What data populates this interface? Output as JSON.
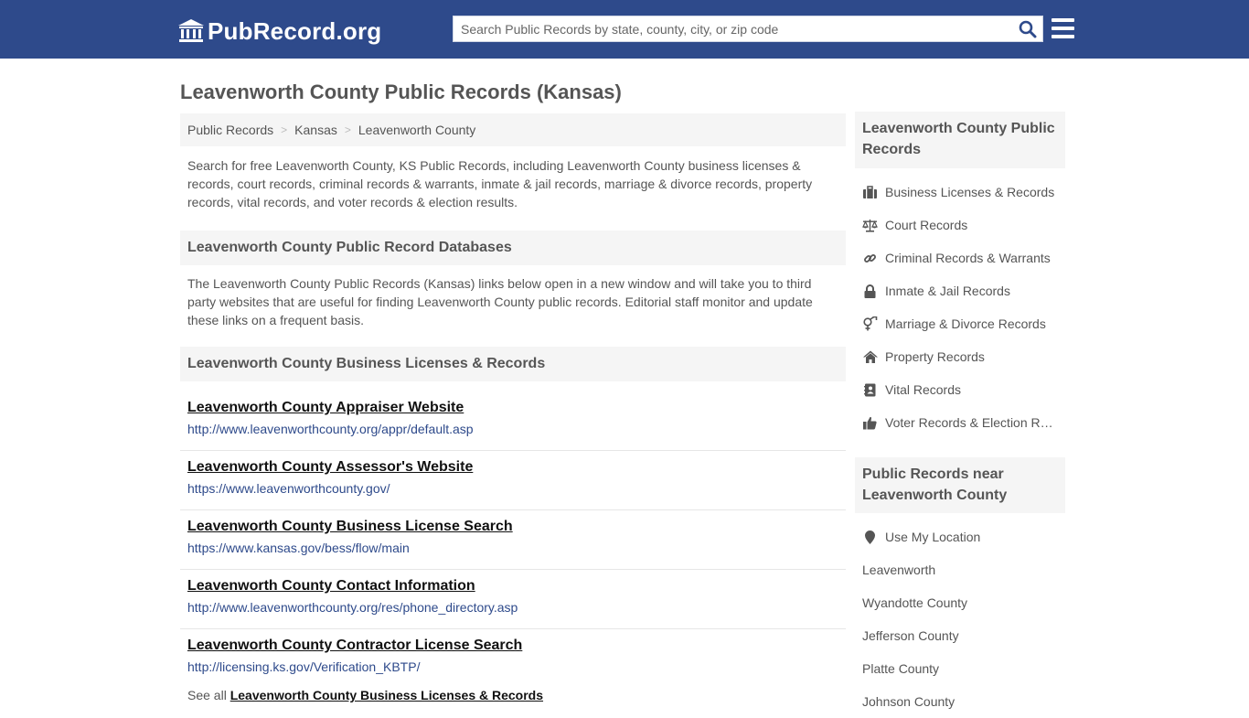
{
  "header": {
    "logo_text": "PubRecord.org",
    "search_placeholder": "Search Public Records by state, county, city, or zip code",
    "brand_color": "#2e4a8b"
  },
  "page_title": "Leavenworth County Public Records (Kansas)",
  "breadcrumb": [
    "Public Records",
    "Kansas",
    "Leavenworth County"
  ],
  "intro": "Search for free Leavenworth County, KS Public Records, including Leavenworth County business licenses & records, court records, criminal records & warrants, inmate & jail records, marriage & divorce records, property records, vital records, and voter records & election results.",
  "databases": {
    "heading": "Leavenworth County Public Record Databases",
    "description": "The Leavenworth County Public Records (Kansas) links below open in a new window and will take you to third party websites that are useful for finding Leavenworth County public records. Editorial staff monitor and update these links on a frequent basis."
  },
  "business_section": {
    "heading": "Leavenworth County Business Licenses & Records",
    "links": [
      {
        "title": "Leavenworth County Appraiser Website",
        "url": "http://www.leavenworthcounty.org/appr/default.asp"
      },
      {
        "title": "Leavenworth County Assessor's Website",
        "url": "https://www.leavenworthcounty.gov/"
      },
      {
        "title": "Leavenworth County Business License Search",
        "url": "https://www.kansas.gov/bess/flow/main"
      },
      {
        "title": "Leavenworth County Contact Information",
        "url": "http://www.leavenworthcounty.org/res/phone_directory.asp"
      },
      {
        "title": "Leavenworth County Contractor License Search",
        "url": "http://licensing.ks.gov/Verification_KBTP/"
      }
    ],
    "see_all_prefix": "See all",
    "see_all_link": "Leavenworth County Business Licenses & Records"
  },
  "sidebar": {
    "records_heading": "Leavenworth County Public Records",
    "records_items": [
      {
        "label": "Business Licenses & Records",
        "icon": "briefcase-icon"
      },
      {
        "label": "Court Records",
        "icon": "scales-icon"
      },
      {
        "label": "Criminal Records & Warrants",
        "icon": "link-icon"
      },
      {
        "label": "Inmate & Jail Records",
        "icon": "lock-icon"
      },
      {
        "label": "Marriage & Divorce Records",
        "icon": "gender-icon"
      },
      {
        "label": "Property Records",
        "icon": "home-icon"
      },
      {
        "label": "Vital Records",
        "icon": "address-book-icon"
      },
      {
        "label": "Voter Records & Election Results",
        "icon": "thumbs-up-icon"
      }
    ],
    "nearby_heading": "Public Records near Leavenworth County",
    "nearby_items": [
      {
        "label": "Use My Location",
        "icon": "map-marker-icon"
      },
      {
        "label": "Leavenworth"
      },
      {
        "label": "Wyandotte County"
      },
      {
        "label": "Jefferson County"
      },
      {
        "label": "Platte County"
      },
      {
        "label": "Johnson County"
      }
    ]
  }
}
